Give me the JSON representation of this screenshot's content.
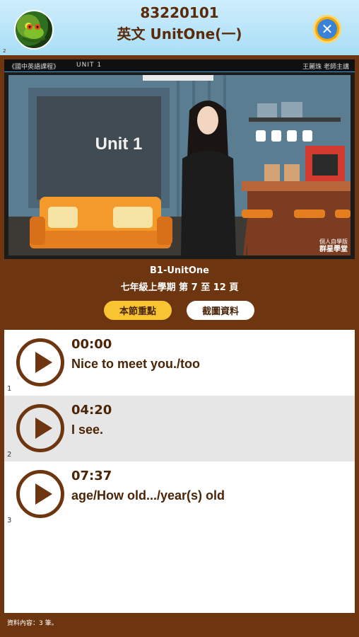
{
  "header": {
    "id": "83220101",
    "title": "英文 UnitOne(一)",
    "small_mark": "2",
    "avatar_icon": "frog-icon",
    "close_icon": "close-icon"
  },
  "video": {
    "top_left": "《國中英語課程》",
    "top_mid": "UNIT 1",
    "top_right": "王麗珠 老師主講",
    "board_text": "Unit 1",
    "brand_line1": "個人自學版",
    "brand_line2": "群星學堂"
  },
  "info": {
    "line1": "B1-UnitOne",
    "line2": "七年級上學期 第 7 至 12 頁"
  },
  "buttons": {
    "key_points": "本節重點",
    "screenshot": "截圖資料"
  },
  "items": [
    {
      "time": "00:00",
      "text": "Nice to meet you./too",
      "index": "1"
    },
    {
      "time": "04:20",
      "text": "I see.",
      "index": "2"
    },
    {
      "time": "07:37",
      "text": "age/How old.../year(s) old",
      "index": "3"
    }
  ],
  "footer": "資料內容：3 筆。",
  "colors": {
    "brown": "#6e3610",
    "accent": "#f9c431",
    "close_blue": "#3a82d8"
  }
}
